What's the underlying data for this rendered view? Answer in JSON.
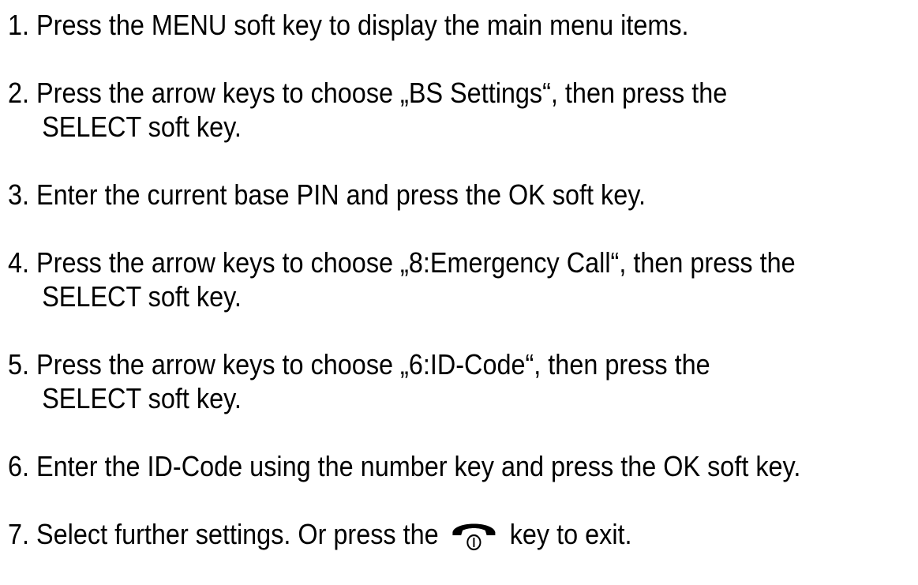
{
  "steps": [
    {
      "num": "1.",
      "line1": "Press the MENU soft key to display the main menu items.",
      "line2": ""
    },
    {
      "num": "2.",
      "line1": "Press the arrow keys to choose „BS Settings“, then press the",
      "line2": "SELECT soft key."
    },
    {
      "num": "3.",
      "line1": "Enter the current base PIN and press the OK soft key.",
      "line2": ""
    },
    {
      "num": "4.",
      "line1": "Press the arrow keys to choose „8:Emergency Call“, then press the",
      "line2": "SELECT soft key."
    },
    {
      "num": "5.",
      "line1": "Press the arrow keys to choose „6:ID-Code“, then press the",
      "line2": "SELECT soft key."
    },
    {
      "num": "6.",
      "line1": "Enter the ID-Code using the number key and press the OK soft key.",
      "line2": ""
    },
    {
      "num": "7.",
      "line1_before": "Select further settings. Or press the",
      "line1_after": "key to exit."
    }
  ],
  "icons": {
    "end_call": "end-call-key-icon"
  }
}
